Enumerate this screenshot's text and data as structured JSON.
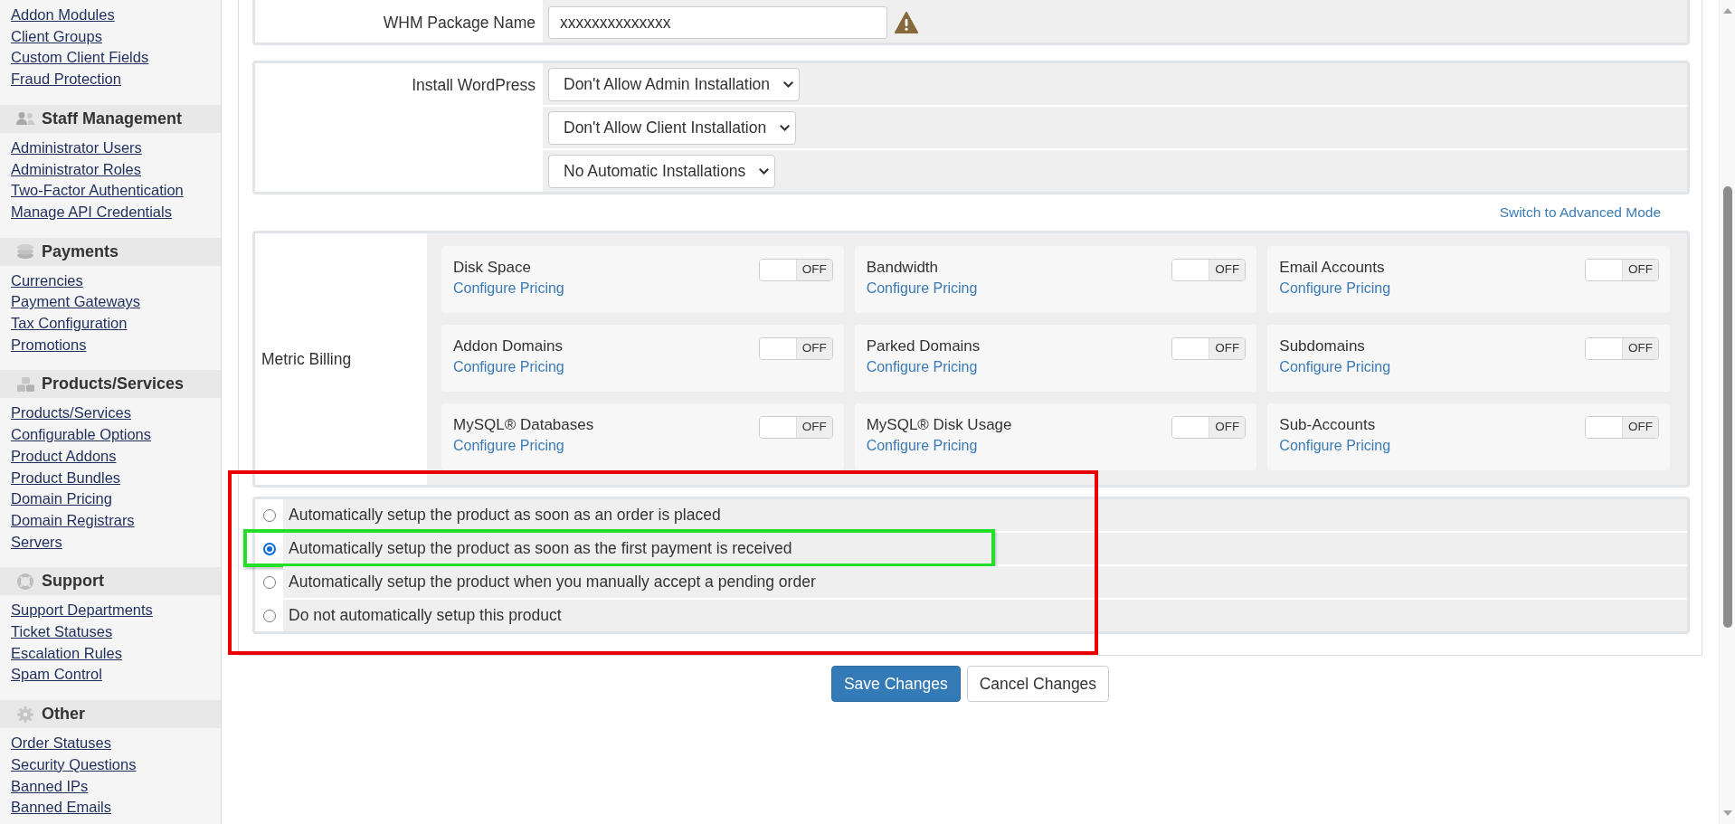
{
  "sidebar": {
    "links": [
      "Addon Modules",
      "Client Groups",
      "Custom Client Fields",
      "Fraud Protection"
    ],
    "sections": [
      {
        "title": "Staff Management",
        "links": [
          "Administrator Users",
          "Administrator Roles",
          "Two-Factor Authentication",
          "Manage API Credentials"
        ]
      },
      {
        "title": "Payments",
        "links": [
          "Currencies",
          "Payment Gateways",
          "Tax Configuration",
          "Promotions"
        ]
      },
      {
        "title": "Products/Services",
        "links": [
          "Products/Services",
          "Configurable Options",
          "Product Addons",
          "Product Bundles",
          "Domain Pricing",
          "Domain Registrars",
          "Servers"
        ]
      },
      {
        "title": "Support",
        "links": [
          "Support Departments",
          "Ticket Statuses",
          "Escalation Rules",
          "Spam Control"
        ]
      },
      {
        "title": "Other",
        "links": [
          "Order Statuses",
          "Security Questions",
          "Banned IPs",
          "Banned Emails"
        ]
      }
    ]
  },
  "package_name": {
    "label": "WHM Package Name",
    "value": "xxxxxxxxxxxxxx",
    "warning": true
  },
  "install_wordpress": {
    "label": "Install WordPress",
    "dropdowns": [
      "Don't Allow Admin Installation",
      "Don't Allow Client Installation",
      "No Automatic Installations"
    ]
  },
  "advanced_mode_link": "Switch to Advanced Mode",
  "metric_billing": {
    "label": "Metric Billing",
    "metrics": [
      {
        "name": "Disk Space",
        "link": "Configure Pricing",
        "switch_label": "OFF",
        "on": false
      },
      {
        "name": "Bandwidth",
        "link": "Configure Pricing",
        "switch_label": "OFF",
        "on": false
      },
      {
        "name": "Email Accounts",
        "link": "Configure Pricing",
        "switch_label": "OFF",
        "on": false
      },
      {
        "name": "Addon Domains",
        "link": "Configure Pricing",
        "switch_label": "OFF",
        "on": false
      },
      {
        "name": "Parked Domains",
        "link": "Configure Pricing",
        "switch_label": "OFF",
        "on": false
      },
      {
        "name": "Subdomains",
        "link": "Configure Pricing",
        "switch_label": "OFF",
        "on": false
      },
      {
        "name": "MySQL® Databases",
        "link": "Configure Pricing",
        "switch_label": "OFF",
        "on": false
      },
      {
        "name": "MySQL® Disk Usage",
        "link": "Configure Pricing",
        "switch_label": "OFF",
        "on": false
      },
      {
        "name": "Sub-Accounts",
        "link": "Configure Pricing",
        "switch_label": "OFF",
        "on": false
      }
    ]
  },
  "auto_setup": {
    "highlighted": true,
    "options": [
      {
        "label": "Automatically setup the product as soon as an order is placed",
        "selected": false,
        "highlighted": false
      },
      {
        "label": "Automatically setup the product as soon as the first payment is received",
        "selected": true,
        "highlighted": true
      },
      {
        "label": "Automatically setup the product when you manually accept a pending order",
        "selected": false,
        "highlighted": false
      },
      {
        "label": "Do not automatically setup this product",
        "selected": false,
        "highlighted": false
      }
    ]
  },
  "buttons": [
    {
      "label": "Save Changes",
      "kind": "primary"
    },
    {
      "label": "Cancel Changes",
      "kind": "default"
    }
  ]
}
